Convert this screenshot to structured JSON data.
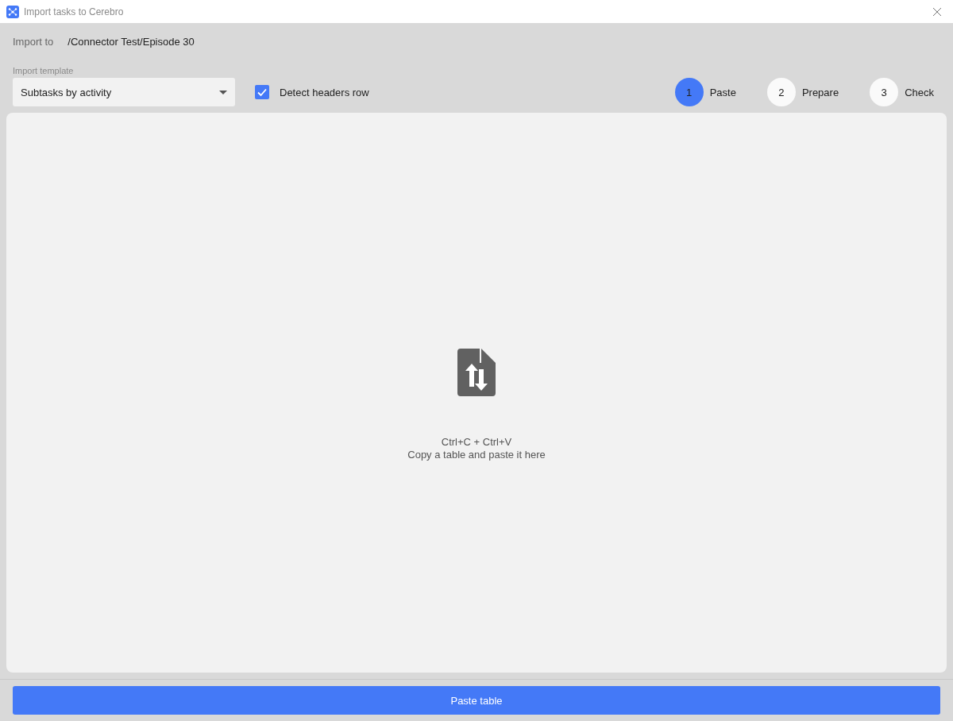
{
  "window": {
    "title": "Import tasks to Cerebro"
  },
  "import_to": {
    "label": "Import to",
    "path": "/Connector Test/Episode 30"
  },
  "template": {
    "label": "Import template",
    "value": "Subtasks by activity"
  },
  "detect_headers": {
    "label": "Detect headers row",
    "checked": true
  },
  "steps": [
    {
      "number": "1",
      "label": "Paste",
      "selected": true
    },
    {
      "number": "2",
      "label": "Prepare",
      "selected": false
    },
    {
      "number": "3",
      "label": "Check",
      "selected": false
    }
  ],
  "drop_area": {
    "shortcut": "Ctrl+C + Ctrl+V",
    "hint": "Copy a table and paste it here"
  },
  "paste_button": "Paste table"
}
